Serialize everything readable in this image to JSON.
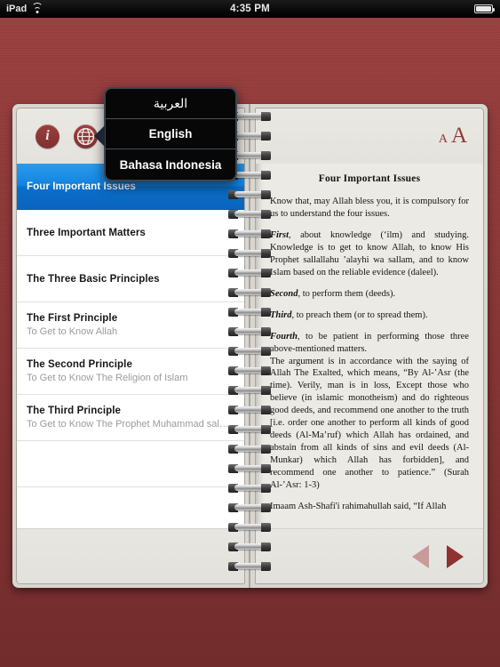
{
  "statusbar": {
    "device": "iPad",
    "time": "4:35 PM",
    "wifi_icon": "wifi-icon",
    "battery_icon": "battery-icon"
  },
  "left_page": {
    "toolbar": {
      "info_label": "i",
      "info_icon": "info-icon",
      "globe_icon": "globe-icon"
    },
    "toc": [
      {
        "title": "Four Important Issues",
        "subtitle": "",
        "selected": true
      },
      {
        "title": "Three Important Matters",
        "subtitle": "",
        "selected": false
      },
      {
        "title": "The Three Basic Principles",
        "subtitle": "",
        "selected": false
      },
      {
        "title": "The First Principle",
        "subtitle": "To Get to Know Allah",
        "selected": false
      },
      {
        "title": "The Second Principle",
        "subtitle": "To Get to Know The Religion of Islam",
        "selected": false
      },
      {
        "title": "The Third Principle",
        "subtitle": "To Get to Know The Prophet Muhammad sal…",
        "selected": false
      }
    ]
  },
  "right_page": {
    "toolbar": {
      "font_small": "A",
      "font_large": "A"
    },
    "title": "Four Important Issues",
    "paragraphs": [
      {
        "lead": "",
        "text": "Know that, may Allah bless you, it is compulsory for us to understand the four issues."
      },
      {
        "lead": "First",
        "text": ", about knowledge (ʻilm) and studying. Knowledge is to get to know Allah, to know His Prophet sallallahu ’alayhi wa sallam, and to know Islam based on the reliable evidence (daleel)."
      },
      {
        "lead": "Second",
        "text": ", to perform them (deeds)."
      },
      {
        "lead": "Third",
        "text": ", to preach them (or to spread them)."
      },
      {
        "lead": "Fourth",
        "text": ", to be patient in performing those three above-mentioned matters."
      },
      {
        "lead": "",
        "text": "The argument is in accordance with the saying of Allah The Exalted, which means, “By Al-’Asr (the time). Verily, man is in loss, Except those who believe (in islamic monotheism) and do righteous good deeds, and recommend one another to the truth [i.e. order one another to perform all kinds of good deeds (Al-Ma’ruf) which Allah has ordained, and abstain from all kinds of sins and evil deeds (Al-Munkar) which Allah has forbidden], and recommend one another to patience.” (Surah Al-’Asr: 1-3)"
      },
      {
        "lead": "",
        "text": "Imaam Ash-Shafi'i rahimahullah said, “If Allah"
      }
    ],
    "nav": {
      "prev_icon": "prev-arrow-icon",
      "next_icon": "next-arrow-icon"
    }
  },
  "language_popover": {
    "items": [
      {
        "label": "العربية",
        "rtl": true
      },
      {
        "label": "English",
        "rtl": false
      },
      {
        "label": "Bahasa Indonesia",
        "rtl": false
      }
    ]
  },
  "colors": {
    "background_red": "#8E3838",
    "accent_dark_red": "#8E3232",
    "selection_blue": "#1283E0",
    "page_beige": "#ECEAE5"
  }
}
